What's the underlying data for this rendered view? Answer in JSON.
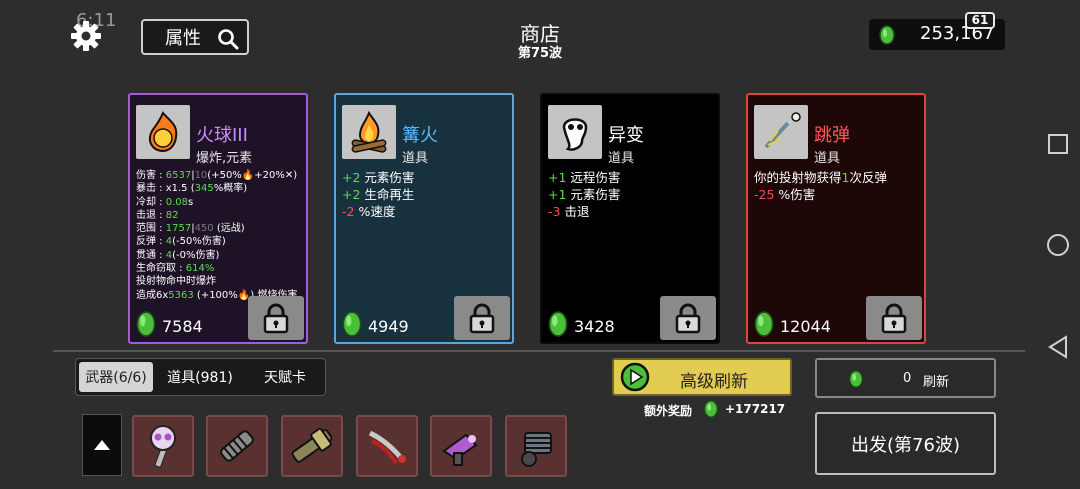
{
  "status": {
    "time": "6:11",
    "battery": "61"
  },
  "header": {
    "attr_label": "属性",
    "title": "商店",
    "wave": "第75波",
    "money": "253,167"
  },
  "cards": [
    {
      "name": "火球III",
      "category": "爆炸,元素",
      "price": "7584",
      "border": "#a65bd8",
      "bg": "#1e1226",
      "name_color": "#c78bff",
      "stats": [
        [
          [
            "伤害 : ",
            ""
          ],
          [
            "6537",
            "g"
          ],
          [
            "|",
            ""
          ],
          [
            "10",
            "gr"
          ],
          [
            "(+50%",
            ""
          ],
          [
            "🔥",
            "o"
          ],
          [
            "+20%✕)",
            ""
          ]
        ],
        [
          [
            "暴击 : x1.5 (",
            ""
          ],
          [
            "345",
            "g"
          ],
          [
            "%概率)",
            ""
          ]
        ],
        [
          [
            "冷却 : ",
            ""
          ],
          [
            "0.08",
            "g"
          ],
          [
            "s",
            ""
          ]
        ],
        [
          [
            "击退 : ",
            ""
          ],
          [
            "82",
            "g"
          ]
        ],
        [
          [
            "范围 : ",
            ""
          ],
          [
            "1757",
            "g"
          ],
          [
            "|",
            ""
          ],
          [
            "450",
            "gr"
          ],
          [
            " (远战)",
            ""
          ]
        ],
        [
          [
            "反弹 : ",
            ""
          ],
          [
            "4",
            "g"
          ],
          [
            "(-50%伤害)",
            ""
          ]
        ],
        [
          [
            "贯通 : ",
            ""
          ],
          [
            "4",
            "g"
          ],
          [
            "(-0%伤害)",
            ""
          ]
        ],
        [
          [
            "生命窃取 : ",
            ""
          ],
          [
            "614%",
            "g"
          ]
        ],
        [
          [
            "投射物命中时爆炸",
            ""
          ]
        ],
        [
          [
            "造成6x",
            ""
          ],
          [
            "5363",
            "g"
          ],
          [
            " (+100%",
            ""
          ],
          [
            "🔥",
            "o"
          ],
          [
            ")  燃烧伤害",
            ""
          ]
        ]
      ]
    },
    {
      "name": "篝火",
      "category": "道具",
      "price": "4949",
      "border": "#5aa6de",
      "bg": "#17313f",
      "name_color": "#58b8ff",
      "stats": [
        [
          [
            "+2",
            "g"
          ],
          [
            " 元素伤害",
            ""
          ]
        ],
        [
          [
            "+2",
            "g"
          ],
          [
            " 生命再生",
            ""
          ]
        ],
        [
          [
            "-2",
            "r"
          ],
          [
            " %速度",
            ""
          ]
        ]
      ]
    },
    {
      "name": "异变",
      "category": "道具",
      "price": "3428",
      "border": "#0a0a0a",
      "bg": "#000000",
      "name_color": "#ffffff",
      "stats": [
        [
          [
            "+1",
            "g"
          ],
          [
            " 远程伤害",
            ""
          ]
        ],
        [
          [
            "+1",
            "g"
          ],
          [
            " 元素伤害",
            ""
          ]
        ],
        [
          [
            "-3",
            "r"
          ],
          [
            " 击退",
            ""
          ]
        ]
      ]
    },
    {
      "name": "跳弹",
      "category": "道具",
      "price": "12044",
      "border": "#d84545",
      "bg": "#1e0707",
      "name_color": "#ff5a5a",
      "stats": [
        [
          [
            "你的投射物获得",
            ""
          ],
          [
            "1",
            "g"
          ],
          [
            "次反弹",
            ""
          ]
        ],
        [
          [
            "-25",
            "r"
          ],
          [
            " %伤害",
            ""
          ]
        ]
      ]
    }
  ],
  "bottom": {
    "tabs": [
      "武器(6/6)",
      "道具(981)",
      "天赋卡"
    ],
    "adv_refresh": "高级刷新",
    "bonus_label": "额外奖励",
    "bonus_value": "+177217",
    "refresh_cost": "0",
    "refresh_label": "刷新",
    "depart": "出发(第76波)"
  },
  "colors": {
    "gem": "#4cbf3a",
    "adv_button": "#e2cc52",
    "slot": "#5a3131"
  },
  "weapon_slots": [
    "skull-staff-icon",
    "spring-gun-icon",
    "bazooka-icon",
    "claw-weapon-icon",
    "plasma-gun-icon",
    "minigun-icon"
  ]
}
